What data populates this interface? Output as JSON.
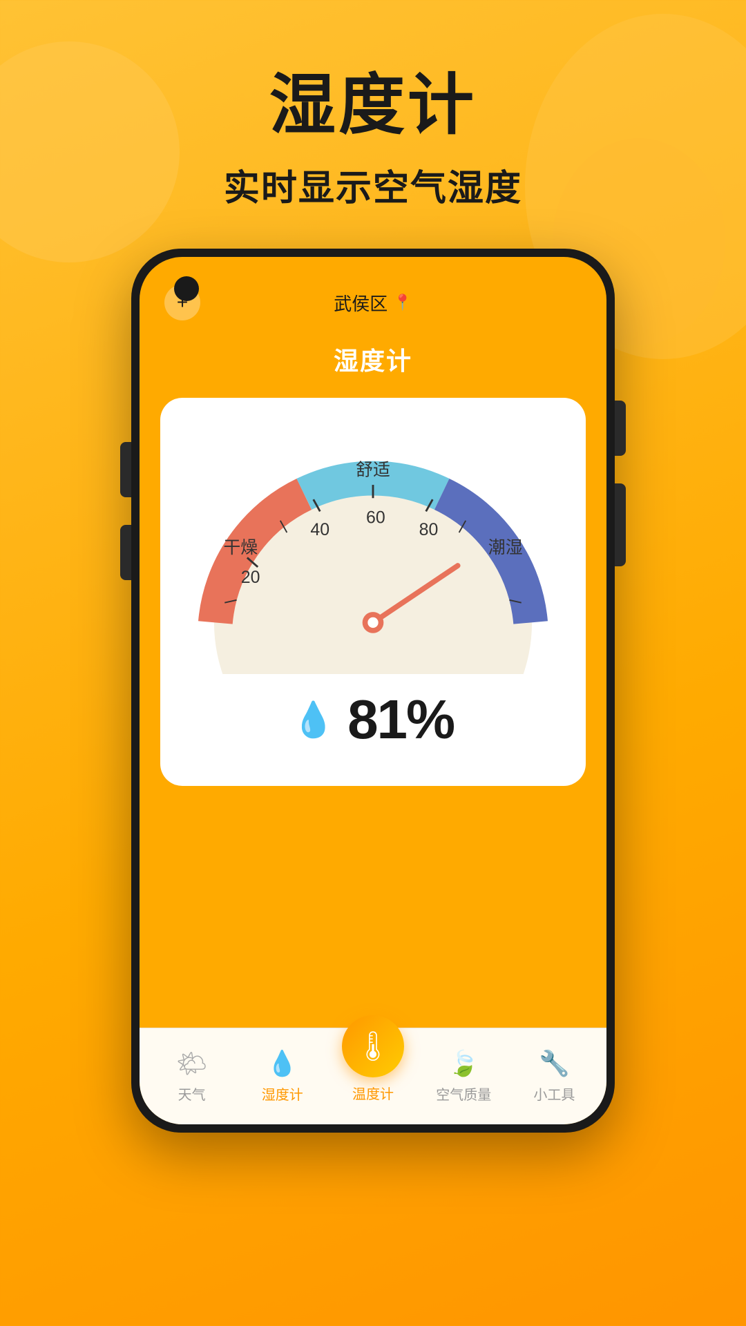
{
  "page": {
    "background_color": "#FFAA00"
  },
  "header": {
    "main_title": "湿度计",
    "sub_title": "实时显示空气湿度"
  },
  "phone": {
    "location": "武侯区",
    "page_title": "湿度计",
    "plus_icon": "+",
    "location_pin": "📍"
  },
  "gauge": {
    "label_dry": "干燥",
    "label_comfort": "舒适",
    "label_humid": "潮湿",
    "tick_20": "20",
    "tick_40": "40",
    "tick_60": "60",
    "tick_80": "80",
    "humidity_value": "81%",
    "water_drop": "💧"
  },
  "nav": {
    "items": [
      {
        "label": "天气",
        "icon": "🌤",
        "active": false
      },
      {
        "label": "湿度计",
        "icon": "💧",
        "active": false
      },
      {
        "label": "温度计",
        "icon": "🌡",
        "active": true,
        "center": true
      },
      {
        "label": "空气质量",
        "icon": "🍃",
        "active": false
      },
      {
        "label": "小工具",
        "icon": "🔧",
        "active": false
      }
    ]
  }
}
